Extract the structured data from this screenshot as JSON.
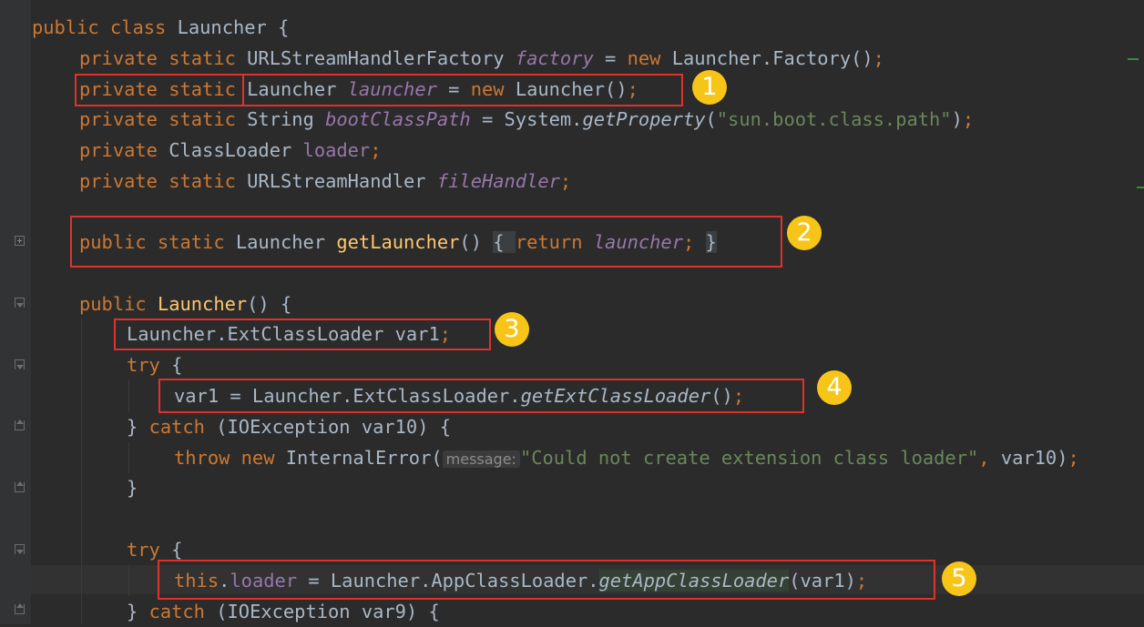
{
  "editor": {
    "lines": [
      [
        {
          "t": "public class ",
          "c": "kw"
        },
        {
          "t": "Launcher {",
          "c": ""
        }
      ],
      [
        {
          "t": "private static ",
          "c": "kw"
        },
        {
          "t": "URLStreamHandlerFactory ",
          "c": ""
        },
        {
          "t": "factory",
          "c": "st"
        },
        {
          "t": " = ",
          "c": ""
        },
        {
          "t": "new ",
          "c": "kw"
        },
        {
          "t": "Launcher.Factory()",
          "c": ""
        },
        {
          "t": ";",
          "c": "kw"
        }
      ],
      [
        {
          "t": "private static ",
          "c": "kw"
        },
        {
          "t": "Launcher ",
          "c": ""
        },
        {
          "t": "launcher",
          "c": "st"
        },
        {
          "t": " = ",
          "c": ""
        },
        {
          "t": "new ",
          "c": "kw"
        },
        {
          "t": "Launcher()",
          "c": ""
        },
        {
          "t": ";",
          "c": "kw"
        }
      ],
      [
        {
          "t": "private static ",
          "c": "kw"
        },
        {
          "t": "String ",
          "c": ""
        },
        {
          "t": "bootClassPath",
          "c": "st"
        },
        {
          "t": " = System.",
          "c": ""
        },
        {
          "t": "getProperty",
          "c": "it"
        },
        {
          "t": "(",
          "c": ""
        },
        {
          "t": "\"sun.boot.class.path\"",
          "c": "str"
        },
        {
          "t": ")",
          "c": ""
        },
        {
          "t": ";",
          "c": "kw"
        }
      ],
      [
        {
          "t": "private ",
          "c": "kw"
        },
        {
          "t": "ClassLoader ",
          "c": ""
        },
        {
          "t": "loader",
          "c": "fld"
        },
        {
          "t": ";",
          "c": "kw"
        }
      ],
      [
        {
          "t": "private static ",
          "c": "kw"
        },
        {
          "t": "URLStreamHandler ",
          "c": ""
        },
        {
          "t": "fileHandler",
          "c": "st"
        },
        {
          "t": ";",
          "c": "kw"
        }
      ],
      [
        {
          "t": "public static ",
          "c": "kw"
        },
        {
          "t": "Launcher ",
          "c": ""
        },
        {
          "t": "getLauncher",
          "c": "fn"
        },
        {
          "t": "()",
          "c": ""
        },
        {
          "t": " ",
          "c": ""
        },
        {
          "t": "{ ",
          "c": "foldbg"
        },
        {
          "t": "return ",
          "c": "kw"
        },
        {
          "t": "launcher",
          "c": "st"
        },
        {
          "t": ";",
          "c": "kw"
        },
        {
          "t": " ",
          "c": ""
        },
        {
          "t": "}",
          "c": "foldbg"
        }
      ],
      [
        {
          "t": "public ",
          "c": "kw"
        },
        {
          "t": "Launcher",
          "c": "fn"
        },
        {
          "t": "() {",
          "c": ""
        }
      ],
      [
        {
          "t": "Launcher.ExtClassLoader var1",
          "c": ""
        },
        {
          "t": ";",
          "c": "kw"
        }
      ],
      [
        {
          "t": "try ",
          "c": "kw"
        },
        {
          "t": "{",
          "c": ""
        }
      ],
      [
        {
          "t": "var1 = Launcher.ExtClassLoader.",
          "c": ""
        },
        {
          "t": "getExtClassLoader",
          "c": "it"
        },
        {
          "t": "()",
          "c": ""
        },
        {
          "t": ";",
          "c": "kw"
        }
      ],
      [
        {
          "t": "} ",
          "c": ""
        },
        {
          "t": "catch ",
          "c": "kw"
        },
        {
          "t": "(IOException var10) {",
          "c": ""
        }
      ],
      [
        {
          "t": "throw new ",
          "c": "kw"
        },
        {
          "t": "InternalError(",
          "c": ""
        },
        {
          "t": "message:",
          "c": "hintbox"
        },
        {
          "t": "\"Could not create extension class loader\"",
          "c": "str"
        },
        {
          "t": ", ",
          "c": "kw"
        },
        {
          "t": "var10)",
          "c": ""
        },
        {
          "t": ";",
          "c": "kw"
        }
      ],
      [
        {
          "t": "}",
          "c": ""
        }
      ],
      [
        {
          "t": "try ",
          "c": "kw"
        },
        {
          "t": "{",
          "c": ""
        }
      ],
      [
        {
          "t": "this",
          "c": "kw"
        },
        {
          "t": ".",
          "c": ""
        },
        {
          "t": "loader",
          "c": "fld"
        },
        {
          "t": " = Launcher.AppClassLoader.",
          "c": ""
        },
        {
          "t": "getAppClassLoader",
          "c": "it identbg"
        },
        {
          "t": "(var1)",
          "c": ""
        },
        {
          "t": ";",
          "c": "kw"
        }
      ],
      [
        {
          "t": "} ",
          "c": ""
        },
        {
          "t": "catch ",
          "c": "kw"
        },
        {
          "t": "(IOException var9) {",
          "c": ""
        }
      ]
    ]
  },
  "callouts": [
    "1",
    "2",
    "3",
    "4",
    "5"
  ],
  "colors": {
    "background": "#2b2b2b",
    "keyword": "#cc7832",
    "method": "#ffc66d",
    "field": "#9876aa",
    "string": "#6a8759",
    "text": "#a9b7c6",
    "annotation_box": "#e0322b",
    "badge": "#f7c518"
  }
}
